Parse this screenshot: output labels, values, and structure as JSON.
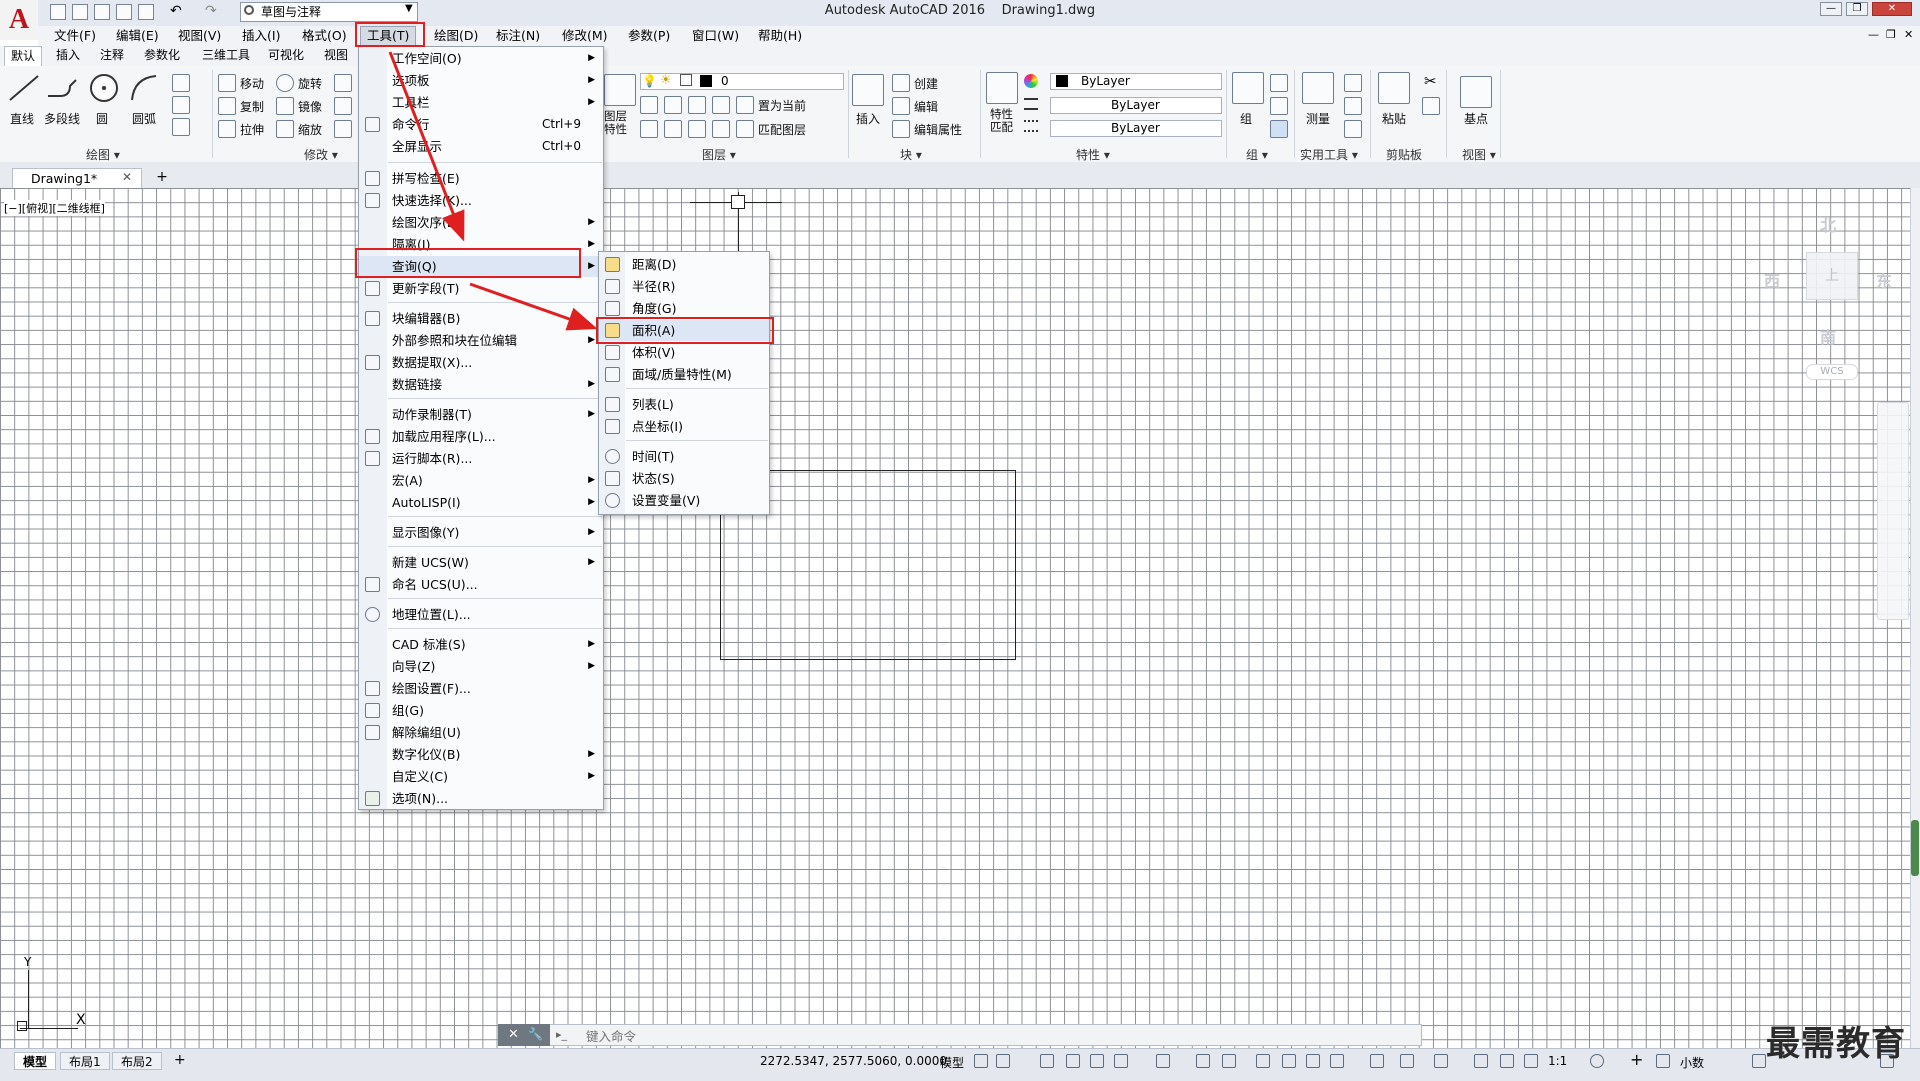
{
  "title": {
    "app": "Autodesk AutoCAD 2016",
    "file": "Drawing1.dwg",
    "workspace": "草图与注释"
  },
  "menubar": [
    "文件(F)",
    "编辑(E)",
    "视图(V)",
    "插入(I)",
    "格式(O)",
    "工具(T)",
    "绘图(D)",
    "标注(N)",
    "修改(M)",
    "参数(P)",
    "窗口(W)",
    "帮助(H)"
  ],
  "ribbon": {
    "tabs": [
      "默认",
      "插入",
      "注释",
      "参数化",
      "三维工具",
      "可视化",
      "视图"
    ],
    "draw_tools": [
      "直线",
      "多段线",
      "圆",
      "圆弧"
    ],
    "modify_tools": [
      "移动",
      "旋转",
      "复制",
      "镜像",
      "拉伸",
      "缩放"
    ],
    "layer_tools": [
      "置为当前",
      "匹配图层"
    ],
    "layer_name": "0",
    "layer_props_label": "图层\n特性",
    "block_tools": [
      "创建",
      "编辑",
      "编辑属性"
    ],
    "insert_label": "插入",
    "match_props_label": "特性\n匹配",
    "bylayer": [
      "ByLayer",
      "ByLayer",
      "ByLayer"
    ],
    "group_label": "组",
    "measure_label": "测量",
    "paste_label": "粘贴",
    "base_label": "基点",
    "panels": [
      "绘图",
      "修改",
      "图层",
      "块",
      "特性",
      "组",
      "实用工具",
      "剪贴板",
      "视图"
    ]
  },
  "doc_tab": "Drawing1*",
  "viewport_label": "[−][俯视][二维线框]",
  "viewcube": {
    "north": "北",
    "south": "南",
    "east": "东",
    "west": "西",
    "face": "上",
    "wcs": "WCS"
  },
  "ucs": {
    "x": "X",
    "y": "Y"
  },
  "command": {
    "placeholder": "键入命令"
  },
  "tools_menu": [
    {
      "label": "工作空间(O)",
      "arrow": true
    },
    {
      "label": "选项板",
      "arrow": true
    },
    {
      "label": "工具栏",
      "arrow": true
    },
    {
      "label": "命令行",
      "shortcut": "Ctrl+9"
    },
    {
      "label": "全屏显示",
      "shortcut": "Ctrl+0"
    },
    {
      "label": "拼写检查(E)"
    },
    {
      "label": "快速选择(K)..."
    },
    {
      "label": "绘图次序(D)",
      "arrow": true
    },
    {
      "label": "隔离(I)",
      "arrow": true
    },
    {
      "label": "查询(Q)",
      "arrow": true
    },
    {
      "label": "更新字段(T)"
    },
    {
      "label": "块编辑器(B)"
    },
    {
      "label": "外部参照和块在位编辑",
      "arrow": true
    },
    {
      "label": "数据提取(X)..."
    },
    {
      "label": "数据链接",
      "arrow": true
    },
    {
      "label": "动作录制器(T)",
      "arrow": true
    },
    {
      "label": "加载应用程序(L)..."
    },
    {
      "label": "运行脚本(R)..."
    },
    {
      "label": "宏(A)",
      "arrow": true
    },
    {
      "label": "AutoLISP(I)",
      "arrow": true
    },
    {
      "label": "显示图像(Y)",
      "arrow": true
    },
    {
      "label": "新建 UCS(W)",
      "arrow": true
    },
    {
      "label": "命名 UCS(U)..."
    },
    {
      "label": "地理位置(L)..."
    },
    {
      "label": "CAD 标准(S)",
      "arrow": true
    },
    {
      "label": "向导(Z)",
      "arrow": true
    },
    {
      "label": "绘图设置(F)..."
    },
    {
      "label": "组(G)"
    },
    {
      "label": "解除编组(U)"
    },
    {
      "label": "数字化仪(B)",
      "arrow": true
    },
    {
      "label": "自定义(C)",
      "arrow": true
    },
    {
      "label": "选项(N)..."
    }
  ],
  "query_menu": [
    "距离(D)",
    "半径(R)",
    "角度(G)",
    "面积(A)",
    "体积(V)",
    "面域/质量特性(M)",
    "列表(L)",
    "点坐标(I)",
    "时间(T)",
    "状态(S)",
    "设置变量(V)"
  ],
  "status": {
    "tabs": [
      "模型",
      "布局1",
      "布局2"
    ],
    "coords": "2272.5347, 2577.5060, 0.0000",
    "mode": "模型",
    "scale": "1:1",
    "units": "小数"
  },
  "watermark": "最需教育",
  "colors": {
    "highlight_red": "#e02020",
    "menu_hover": "#dce6f4",
    "grid": "#8b9096"
  }
}
